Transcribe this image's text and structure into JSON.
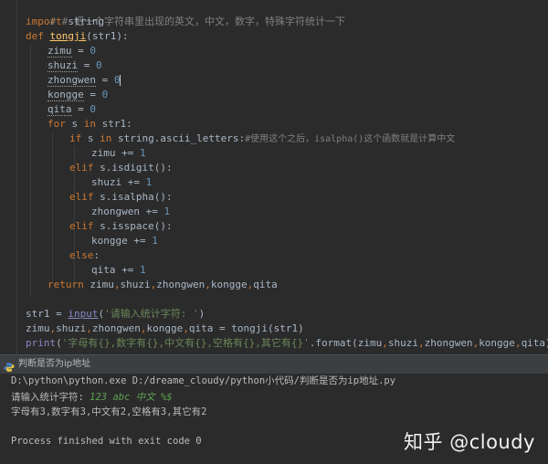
{
  "editor": {
    "line1": "# # 把一个字符串里出现的英文，中文，数字，特殊字符统计一下",
    "line2_kw": "import",
    "line2_rest": " string",
    "line3_kw": "def",
    "line3_fn": "tongji",
    "line3_rest": "(str1):",
    "line4_var": "zimu",
    "line4_eq": " = ",
    "line4_num": "0",
    "line5_var": "shuzi",
    "line5_eq": " = ",
    "line5_num": "0",
    "line6_var": "zhongwen",
    "line6_eq": " = ",
    "line6_num": "0",
    "line7_var": "kongge",
    "line7_eq": " = ",
    "line7_num": "0",
    "line8_var": "qita",
    "line8_eq": " = ",
    "line8_num": "0",
    "line9_kw1": "for",
    "line9_mid": " s ",
    "line9_kw2": "in",
    "line9_rest": " str1:",
    "line10_kw1": "if",
    "line10_mid": " s ",
    "line10_kw2": "in",
    "line10_rest": " string.ascii_letters:",
    "line10_cm": "#使用这个之后，isalpha()这个函数就是计算中文",
    "line11_code": "zimu += ",
    "line11_num": "1",
    "line12_kw": "elif",
    "line12_rest": " s.isdigit():",
    "line13_code": "shuzi += ",
    "line13_num": "1",
    "line14_kw": "elif",
    "line14_rest": " s.isalpha():",
    "line15_code": "zhongwen += ",
    "line15_num": "1",
    "line16_kw": "elif",
    "line16_rest": " s.isspace():",
    "line17_code": "kongge += ",
    "line17_num": "1",
    "line18_kw": "else",
    "line18_rest": ":",
    "line19_code": "qita += ",
    "line19_num": "1",
    "line20_kw": "return",
    "line20_a": " zimu",
    "line20_c1": ",",
    "line20_b": "shuzi",
    "line20_c2": ",",
    "line20_c": "zhongwen",
    "line20_c3": ",",
    "line20_d": "kongge",
    "line20_c4": ",",
    "line20_e": "qita",
    "line22_a": "str1 = ",
    "line22_fn": "input",
    "line22_p1": "(",
    "line22_str": "'请输入统计字符: '",
    "line22_p2": ")",
    "line23_a": "zimu",
    "line23_c1": ",",
    "line23_b": "shuzi",
    "line23_c2": ",",
    "line23_c": "zhongwen",
    "line23_c3": ",",
    "line23_d": "kongge",
    "line23_c4": ",",
    "line23_e": "qita",
    "line23_rest": " = tongji(str1)",
    "line24_fn": "print",
    "line24_p1": "(",
    "line24_str": "'字母有{},数字有{},中文有{},空格有{},其它有{}'",
    "line24_mid": ".format(zimu",
    "line24_c1": ",",
    "line24_b": "shuzi",
    "line24_c2": ",",
    "line24_c": "zhongwen",
    "line24_c3": ",",
    "line24_d": "kongge",
    "line24_c4": ",",
    "line24_e": "qita))"
  },
  "run_tab": {
    "title": "判断是否为ip地址"
  },
  "console": {
    "cmd": "D:\\python\\python.exe D:/dreame_cloudy/python小代码/判断是否为ip地址.py",
    "prompt": "请输入统计字符: ",
    "input": "123 abc 中文 %$",
    "output": "字母有3,数字有3,中文有2,空格有3,其它有2",
    "finished": "Process finished with exit code 0"
  },
  "watermark": "知乎 @cloudy"
}
